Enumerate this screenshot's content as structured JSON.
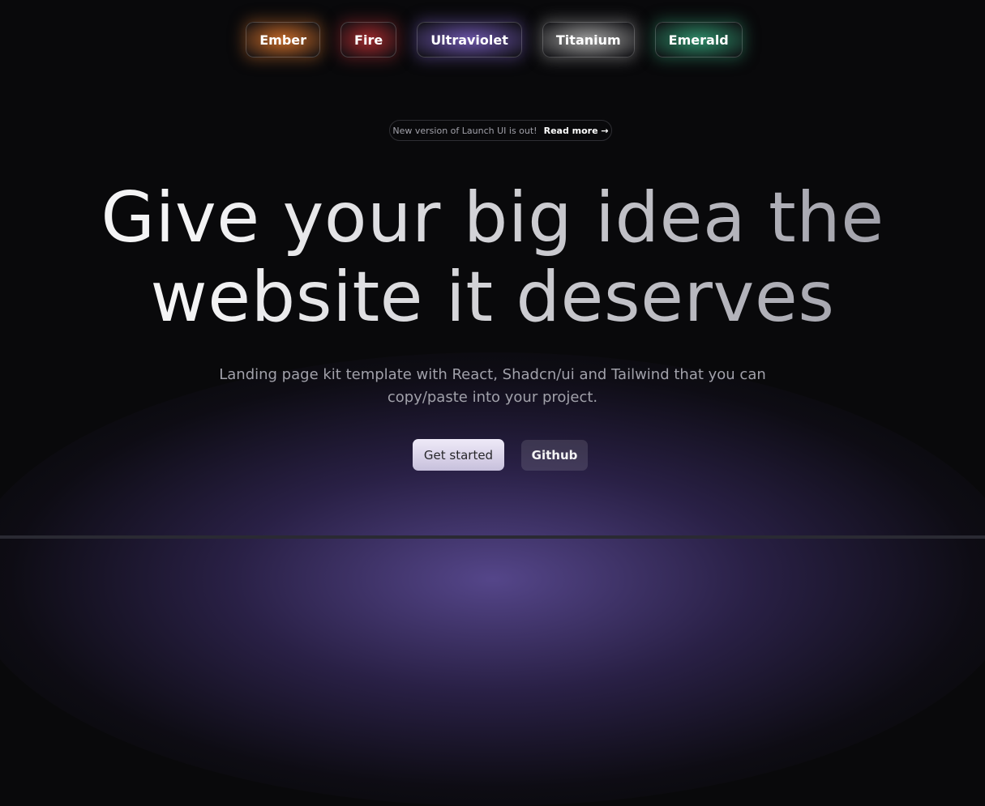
{
  "themes": [
    {
      "label": "Ember",
      "color": "#c0682a"
    },
    {
      "label": "Fire",
      "color": "#9b2a2e"
    },
    {
      "label": "Ultraviolet",
      "color": "#6b55a8"
    },
    {
      "label": "Titanium",
      "color": "#9a9a9a"
    },
    {
      "label": "Emerald",
      "color": "#2f8a68"
    }
  ],
  "announcement": {
    "message": "New version of Launch UI is out!",
    "link": "Read more →"
  },
  "hero": {
    "title_line1": "Give your big idea the",
    "title_line2": "website it deserves",
    "subtitle_line1": "Landing page kit template with React, Shadcn/ui and Tailwind that you can",
    "subtitle_line2": "copy/paste into your project."
  },
  "cta": {
    "primary": "Get started",
    "secondary": "Github"
  }
}
